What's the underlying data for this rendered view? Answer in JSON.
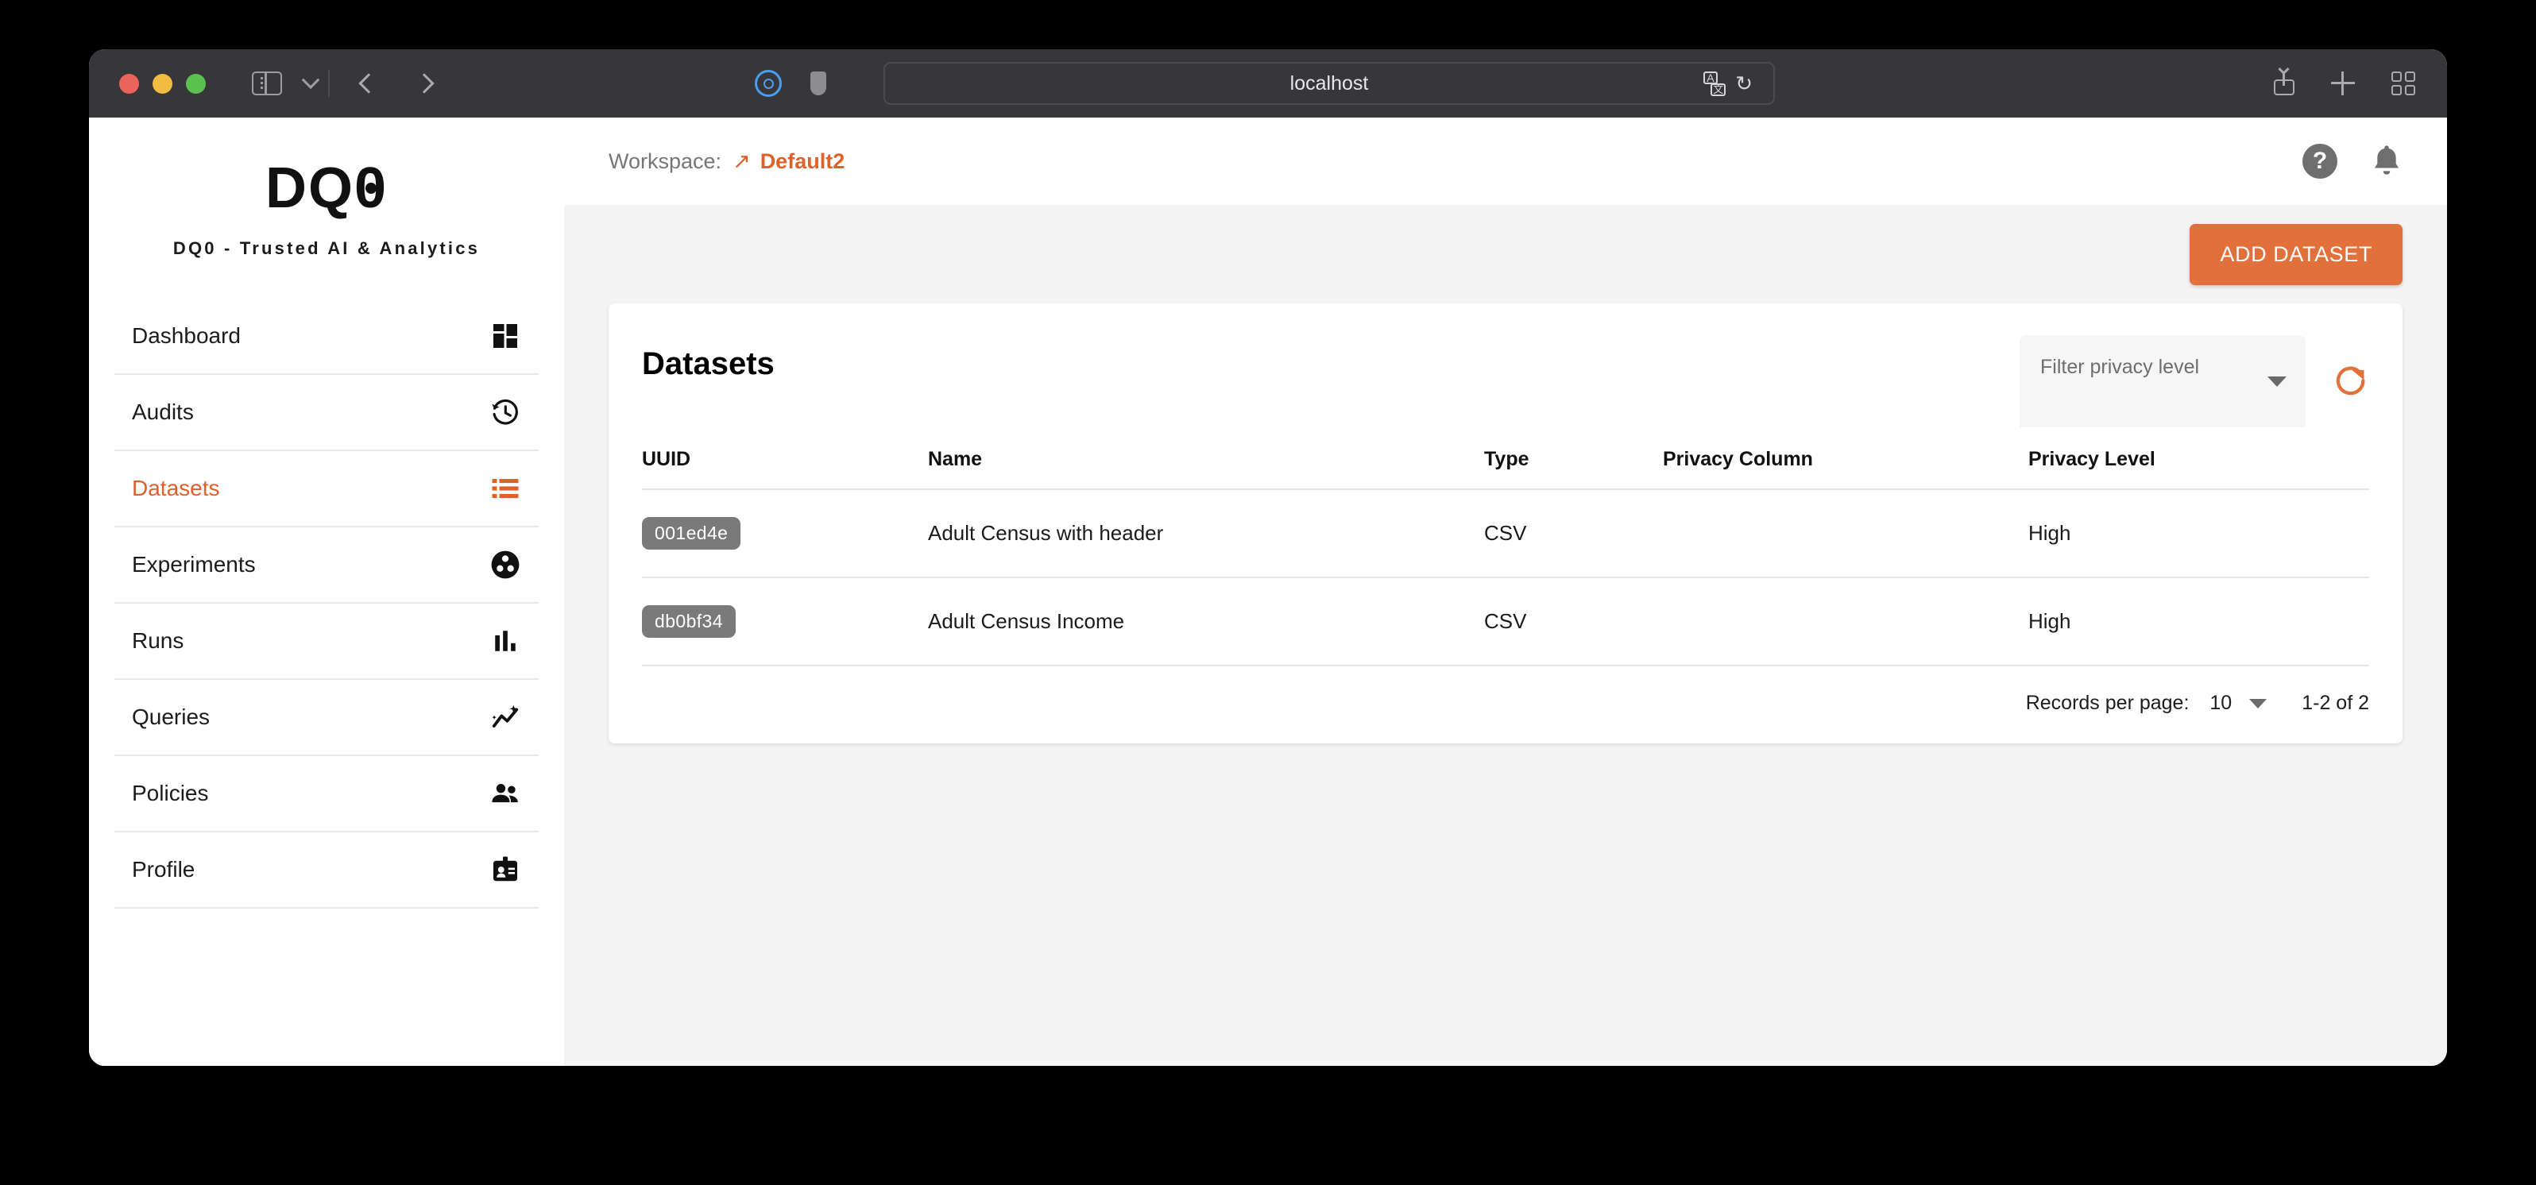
{
  "browser": {
    "url": "localhost",
    "icons": {
      "sidebar_toggle": "sidebar-toggle-icon",
      "back": "back-arrow-icon",
      "forward": "forward-arrow-icon",
      "reader": "reader-mode-icon",
      "shield": "privacy-shield-icon",
      "translate": "translate-icon",
      "reload": "reload-icon",
      "share": "share-icon",
      "new_tab": "plus-icon",
      "tab_overview": "tab-overview-icon"
    }
  },
  "sidebar": {
    "logo_text": "DQ0",
    "tagline": "DQ0 - Trusted AI & Analytics",
    "items": [
      {
        "label": "Dashboard",
        "icon": "dashboard-grid-icon",
        "active": false
      },
      {
        "label": "Audits",
        "icon": "history-clock-icon",
        "active": false
      },
      {
        "label": "Datasets",
        "icon": "list-icon",
        "active": true
      },
      {
        "label": "Experiments",
        "icon": "experiment-dots-icon",
        "active": false
      },
      {
        "label": "Runs",
        "icon": "bar-chart-icon",
        "active": false
      },
      {
        "label": "Queries",
        "icon": "trend-sparkle-icon",
        "active": false
      },
      {
        "label": "Policies",
        "icon": "people-icon",
        "active": false
      },
      {
        "label": "Profile",
        "icon": "id-badge-icon",
        "active": false
      }
    ]
  },
  "topbar": {
    "workspace_label": "Workspace:",
    "workspace_arrow": "↗",
    "workspace_name": "Default2",
    "help_glyph": "?",
    "help_icon": "help-icon",
    "bell_icon": "notification-bell-icon"
  },
  "actions": {
    "add_dataset_label": "ADD DATASET"
  },
  "card": {
    "title": "Datasets",
    "filter": {
      "placeholder": "Filter privacy level",
      "value": ""
    },
    "refresh_icon": "refresh-icon",
    "table": {
      "columns": [
        "UUID",
        "Name",
        "Type",
        "Privacy Column",
        "Privacy Level"
      ],
      "rows": [
        {
          "uuid": "001ed4e",
          "name": "Adult Census with header",
          "type": "CSV",
          "privacy_column": "",
          "privacy_level": "High"
        },
        {
          "uuid": "db0bf34",
          "name": "Adult Census Income",
          "type": "CSV",
          "privacy_column": "",
          "privacy_level": "High"
        }
      ]
    },
    "pagination": {
      "records_label": "Records per page:",
      "records_value": "10",
      "range": "1-2 of 2"
    }
  },
  "colors": {
    "accent": "#e2703a",
    "accent_text": "#e0602a",
    "chip_bg": "#7a7a7a",
    "page_bg": "#f4f4f4",
    "chrome_bg": "#37373a"
  }
}
